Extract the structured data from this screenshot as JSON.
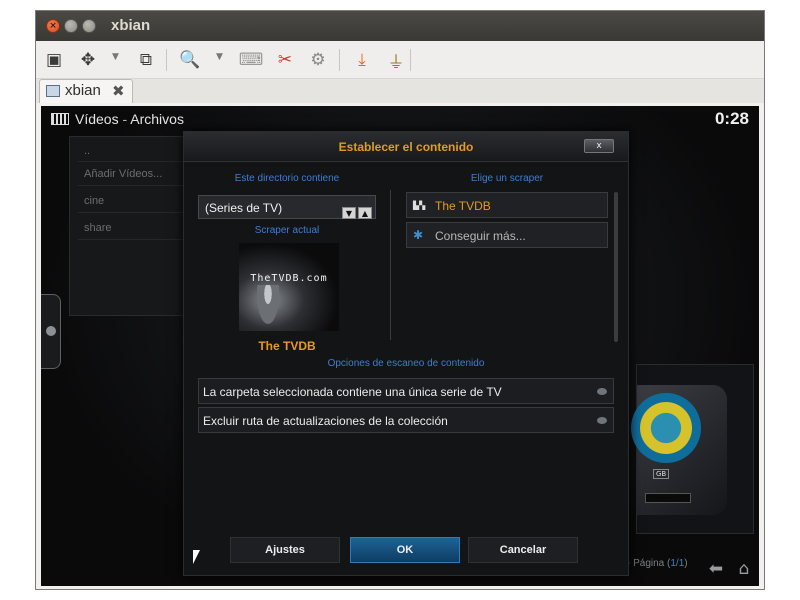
{
  "window": {
    "title": "xbian",
    "close_glyph": "×"
  },
  "toolbar": {
    "icons": [
      "screen-icon",
      "move-icon",
      "windows-icon",
      "zoom-icon",
      "keyboard-icon",
      "tools-icon",
      "settings-icon",
      "download-icon",
      "plug-icon"
    ]
  },
  "tab": {
    "label": "xbian",
    "close": "✖"
  },
  "app": {
    "section": "Vídeos",
    "separator": " - ",
    "subsection": "Archivos",
    "clock": "0:28"
  },
  "sidebar": {
    "items": [
      {
        "label": ".."
      },
      {
        "label": "Añadir Vídeos..."
      },
      {
        "label": "cine"
      },
      {
        "label": "share"
      }
    ]
  },
  "device": {
    "capacity": "GB"
  },
  "paging": {
    "prefix": "- Página (",
    "page": "1/1",
    "suffix": ")"
  },
  "dialog": {
    "title": "Establecer el contenido",
    "close": "x",
    "content_label": "Este directorio contiene",
    "content_value": "(Series de TV)",
    "current_scraper_label": "Scraper actual",
    "thumb_text": "TheTVDB.com",
    "current_scraper_name": "The TVDB",
    "choose_scraper_label": "Elige un scraper",
    "scrapers": [
      {
        "label": "The TVDB",
        "color": "#e59a20",
        "icon": "tvdb-icon"
      },
      {
        "label": "Conseguir más...",
        "color": "#b8b8b8",
        "icon": "puzzle-icon"
      }
    ],
    "scan_options_label": "Opciones de escaneo de contenido",
    "options": [
      {
        "label": "La carpeta seleccionada contiene una única serie de TV"
      },
      {
        "label": "Excluir ruta de actualizaciones de la colección"
      }
    ],
    "buttons": {
      "settings": "Ajustes",
      "ok": "OK",
      "cancel": "Cancelar"
    }
  },
  "colors": {
    "accent_orange": "#e59a20",
    "accent_blue": "#3f7ed0",
    "ok_button": "#1d6396"
  }
}
